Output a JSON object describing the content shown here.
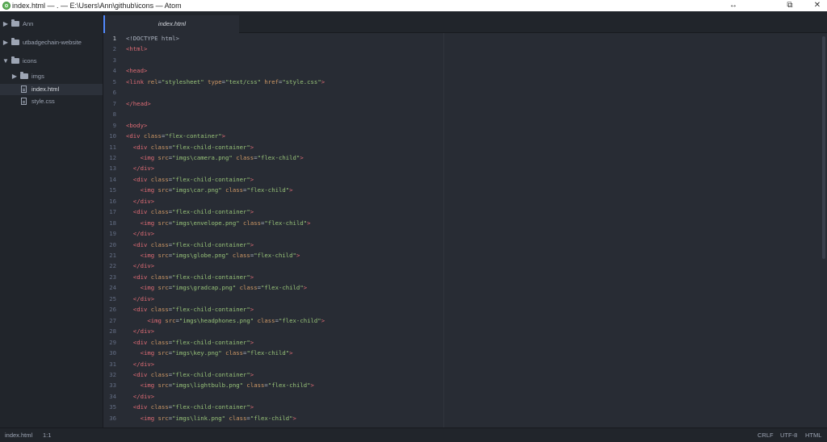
{
  "window": {
    "title": "index.html — . — E:\\Users\\Ann\\github\\icons — Atom",
    "minimize_glyph": "↔",
    "maximize_glyph": "⧉",
    "close_glyph": "✕"
  },
  "sidebar": {
    "items": [
      {
        "label": "Ann",
        "kind": "folder",
        "expanded": false
      },
      {
        "label": "utbadgechain-website",
        "kind": "folder",
        "expanded": false
      },
      {
        "label": "icons",
        "kind": "folder",
        "expanded": true
      },
      {
        "label": "imgs",
        "kind": "folder",
        "expanded": false
      },
      {
        "label": "index.html",
        "kind": "file",
        "selected": true
      },
      {
        "label": "style.css",
        "kind": "file",
        "selected": false
      }
    ]
  },
  "tabs": [
    {
      "label": "index.html",
      "active": true
    }
  ],
  "editor": {
    "current_line": 1,
    "lines": [
      [
        [
          "p",
          "<!DOCTYPE html>"
        ]
      ],
      [
        [
          "t",
          "<html>"
        ]
      ],
      [],
      [
        [
          "t",
          "<head>"
        ]
      ],
      [
        [
          "t",
          "<link "
        ],
        [
          "a",
          "rel"
        ],
        [
          "p",
          "="
        ],
        [
          "s",
          "\"stylesheet\""
        ],
        [
          "p",
          " "
        ],
        [
          "a",
          "type"
        ],
        [
          "p",
          "="
        ],
        [
          "s",
          "\"text/css\""
        ],
        [
          "p",
          " "
        ],
        [
          "a",
          "href"
        ],
        [
          "p",
          "="
        ],
        [
          "s",
          "\"style.css\""
        ],
        [
          "t",
          ">"
        ]
      ],
      [],
      [
        [
          "t",
          "</head>"
        ]
      ],
      [],
      [
        [
          "t",
          "<body>"
        ]
      ],
      [
        [
          "t",
          "<div "
        ],
        [
          "a",
          "class"
        ],
        [
          "p",
          "="
        ],
        [
          "s",
          "\"flex-container\""
        ],
        [
          "t",
          ">"
        ]
      ],
      [
        [
          "p",
          "  "
        ],
        [
          "t",
          "<div "
        ],
        [
          "a",
          "class"
        ],
        [
          "p",
          "="
        ],
        [
          "s",
          "\"flex-child-container\""
        ],
        [
          "t",
          ">"
        ]
      ],
      [
        [
          "p",
          "    "
        ],
        [
          "t",
          "<img "
        ],
        [
          "a",
          "src"
        ],
        [
          "p",
          "="
        ],
        [
          "s",
          "\"imgs\\camera.png\""
        ],
        [
          "p",
          " "
        ],
        [
          "a",
          "class"
        ],
        [
          "p",
          "="
        ],
        [
          "s",
          "\"flex-child\""
        ],
        [
          "t",
          ">"
        ]
      ],
      [
        [
          "p",
          "  "
        ],
        [
          "t",
          "</div>"
        ]
      ],
      [
        [
          "p",
          "  "
        ],
        [
          "t",
          "<div "
        ],
        [
          "a",
          "class"
        ],
        [
          "p",
          "="
        ],
        [
          "s",
          "\"flex-child-container\""
        ],
        [
          "t",
          ">"
        ]
      ],
      [
        [
          "p",
          "    "
        ],
        [
          "t",
          "<img "
        ],
        [
          "a",
          "src"
        ],
        [
          "p",
          "="
        ],
        [
          "s",
          "\"imgs\\car.png\""
        ],
        [
          "p",
          " "
        ],
        [
          "a",
          "class"
        ],
        [
          "p",
          "="
        ],
        [
          "s",
          "\"flex-child\""
        ],
        [
          "t",
          ">"
        ]
      ],
      [
        [
          "p",
          "  "
        ],
        [
          "t",
          "</div>"
        ]
      ],
      [
        [
          "p",
          "  "
        ],
        [
          "t",
          "<div "
        ],
        [
          "a",
          "class"
        ],
        [
          "p",
          "="
        ],
        [
          "s",
          "\"flex-child-container\""
        ],
        [
          "t",
          ">"
        ]
      ],
      [
        [
          "p",
          "    "
        ],
        [
          "t",
          "<img "
        ],
        [
          "a",
          "src"
        ],
        [
          "p",
          "="
        ],
        [
          "s",
          "\"imgs\\envelope.png\""
        ],
        [
          "p",
          " "
        ],
        [
          "a",
          "class"
        ],
        [
          "p",
          "="
        ],
        [
          "s",
          "\"flex-child\""
        ],
        [
          "t",
          ">"
        ]
      ],
      [
        [
          "p",
          "  "
        ],
        [
          "t",
          "</div>"
        ]
      ],
      [
        [
          "p",
          "  "
        ],
        [
          "t",
          "<div "
        ],
        [
          "a",
          "class"
        ],
        [
          "p",
          "="
        ],
        [
          "s",
          "\"flex-child-container\""
        ],
        [
          "t",
          ">"
        ]
      ],
      [
        [
          "p",
          "    "
        ],
        [
          "t",
          "<img "
        ],
        [
          "a",
          "src"
        ],
        [
          "p",
          "="
        ],
        [
          "s",
          "\"imgs\\globe.png\""
        ],
        [
          "p",
          " "
        ],
        [
          "a",
          "class"
        ],
        [
          "p",
          "="
        ],
        [
          "s",
          "\"flex-child\""
        ],
        [
          "t",
          ">"
        ]
      ],
      [
        [
          "p",
          "  "
        ],
        [
          "t",
          "</div>"
        ]
      ],
      [
        [
          "p",
          "  "
        ],
        [
          "t",
          "<div "
        ],
        [
          "a",
          "class"
        ],
        [
          "p",
          "="
        ],
        [
          "s",
          "\"flex-child-container\""
        ],
        [
          "t",
          ">"
        ]
      ],
      [
        [
          "p",
          "    "
        ],
        [
          "t",
          "<img "
        ],
        [
          "a",
          "src"
        ],
        [
          "p",
          "="
        ],
        [
          "s",
          "\"imgs\\gradcap.png\""
        ],
        [
          "p",
          " "
        ],
        [
          "a",
          "class"
        ],
        [
          "p",
          "="
        ],
        [
          "s",
          "\"flex-child\""
        ],
        [
          "t",
          ">"
        ]
      ],
      [
        [
          "p",
          "  "
        ],
        [
          "t",
          "</div>"
        ]
      ],
      [
        [
          "p",
          "  "
        ],
        [
          "t",
          "<div "
        ],
        [
          "a",
          "class"
        ],
        [
          "p",
          "="
        ],
        [
          "s",
          "\"flex-child-container\""
        ],
        [
          "t",
          ">"
        ]
      ],
      [
        [
          "p",
          "      "
        ],
        [
          "t",
          "<img "
        ],
        [
          "a",
          "src"
        ],
        [
          "p",
          "="
        ],
        [
          "s",
          "\"imgs\\headphones.png\""
        ],
        [
          "p",
          " "
        ],
        [
          "a",
          "class"
        ],
        [
          "p",
          "="
        ],
        [
          "s",
          "\"flex-child\""
        ],
        [
          "t",
          ">"
        ]
      ],
      [
        [
          "p",
          "  "
        ],
        [
          "t",
          "</div>"
        ]
      ],
      [
        [
          "p",
          "  "
        ],
        [
          "t",
          "<div "
        ],
        [
          "a",
          "class"
        ],
        [
          "p",
          "="
        ],
        [
          "s",
          "\"flex-child-container\""
        ],
        [
          "t",
          ">"
        ]
      ],
      [
        [
          "p",
          "    "
        ],
        [
          "t",
          "<img "
        ],
        [
          "a",
          "src"
        ],
        [
          "p",
          "="
        ],
        [
          "s",
          "\"imgs\\key.png\""
        ],
        [
          "p",
          " "
        ],
        [
          "a",
          "class"
        ],
        [
          "p",
          "="
        ],
        [
          "s",
          "\"flex-child\""
        ],
        [
          "t",
          ">"
        ]
      ],
      [
        [
          "p",
          "  "
        ],
        [
          "t",
          "</div>"
        ]
      ],
      [
        [
          "p",
          "  "
        ],
        [
          "t",
          "<div "
        ],
        [
          "a",
          "class"
        ],
        [
          "p",
          "="
        ],
        [
          "s",
          "\"flex-child-container\""
        ],
        [
          "t",
          ">"
        ]
      ],
      [
        [
          "p",
          "    "
        ],
        [
          "t",
          "<img "
        ],
        [
          "a",
          "src"
        ],
        [
          "p",
          "="
        ],
        [
          "s",
          "\"imgs\\lightbulb.png\""
        ],
        [
          "p",
          " "
        ],
        [
          "a",
          "class"
        ],
        [
          "p",
          "="
        ],
        [
          "s",
          "\"flex-child\""
        ],
        [
          "t",
          ">"
        ]
      ],
      [
        [
          "p",
          "  "
        ],
        [
          "t",
          "</div>"
        ]
      ],
      [
        [
          "p",
          "  "
        ],
        [
          "t",
          "<div "
        ],
        [
          "a",
          "class"
        ],
        [
          "p",
          "="
        ],
        [
          "s",
          "\"flex-child-container\""
        ],
        [
          "t",
          ">"
        ]
      ],
      [
        [
          "p",
          "    "
        ],
        [
          "t",
          "<img "
        ],
        [
          "a",
          "src"
        ],
        [
          "p",
          "="
        ],
        [
          "s",
          "\"imgs\\link.png\""
        ],
        [
          "p",
          " "
        ],
        [
          "a",
          "class"
        ],
        [
          "p",
          "="
        ],
        [
          "s",
          "\"flex-child\""
        ],
        [
          "t",
          ">"
        ]
      ]
    ]
  },
  "status": {
    "file": "index.html",
    "cursor": "1:1",
    "line_ending": "CRLF",
    "encoding": "UTF-8",
    "grammar": "HTML"
  },
  "colors": {
    "tag": "#e06c75",
    "attribute": "#d19a66",
    "string": "#98c379",
    "accent": "#528bff"
  }
}
